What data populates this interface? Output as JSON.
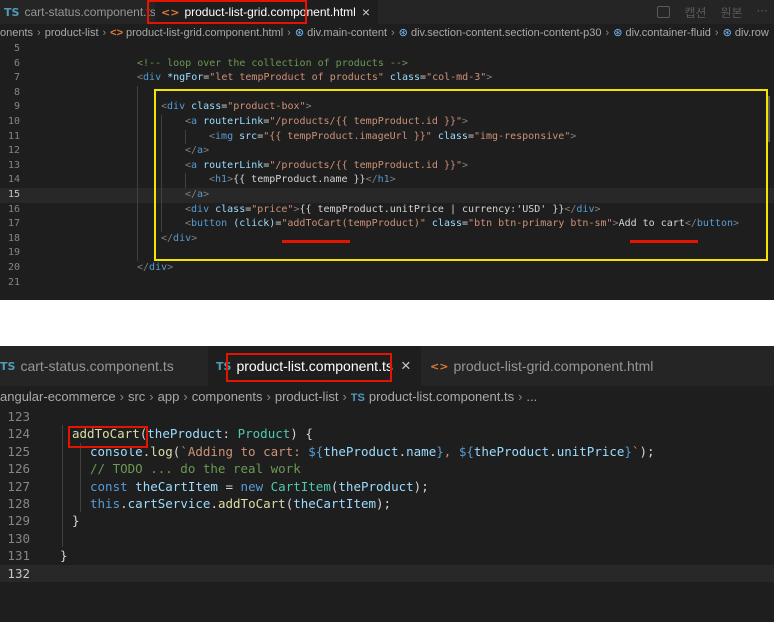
{
  "top_editor": {
    "tabs": [
      {
        "icon": "TS",
        "label": "cart-status.component.ts",
        "active": false
      },
      {
        "icon": "<>",
        "label": "product-list-grid.component.html",
        "active": true
      }
    ],
    "close_glyph": "×",
    "top_right_actions": [
      "캡션",
      "원본",
      "···"
    ],
    "breadcrumb": [
      "onents",
      "product-list",
      "product-list-grid.component.html",
      "div.main-content",
      "div.section-content.section-content-p30",
      "div.container-fluid",
      "div.row"
    ],
    "lines": [
      {
        "n": "5",
        "tokens": []
      },
      {
        "n": "6",
        "tokens": [
          {
            "c": "com",
            "t": "<!-- loop over the collection of products -->"
          }
        ]
      },
      {
        "n": "7",
        "tokens": [
          {
            "c": "br",
            "t": "<"
          },
          {
            "c": "tag",
            "t": "div"
          },
          {
            "c": "txt",
            "t": " "
          },
          {
            "c": "attr",
            "t": "*ngFor"
          },
          {
            "c": "txt",
            "t": "="
          },
          {
            "c": "str",
            "t": "\"let tempProduct of products\""
          },
          {
            "c": "txt",
            "t": " "
          },
          {
            "c": "attr",
            "t": "class"
          },
          {
            "c": "txt",
            "t": "="
          },
          {
            "c": "str",
            "t": "\"col-md-3\""
          },
          {
            "c": "br",
            "t": ">"
          }
        ]
      },
      {
        "n": "8",
        "tokens": []
      },
      {
        "n": "9",
        "tokens": [
          {
            "c": "br",
            "t": "<"
          },
          {
            "c": "tag",
            "t": "div"
          },
          {
            "c": "txt",
            "t": " "
          },
          {
            "c": "attr",
            "t": "class"
          },
          {
            "c": "txt",
            "t": "="
          },
          {
            "c": "str",
            "t": "\"product-box\""
          },
          {
            "c": "br",
            "t": ">"
          }
        ]
      },
      {
        "n": "10",
        "tokens": [
          {
            "c": "br",
            "t": "<"
          },
          {
            "c": "tag",
            "t": "a"
          },
          {
            "c": "txt",
            "t": " "
          },
          {
            "c": "attr",
            "t": "routerLink"
          },
          {
            "c": "txt",
            "t": "="
          },
          {
            "c": "str",
            "t": "\"/products/{{ tempProduct.id }}\""
          },
          {
            "c": "br",
            "t": ">"
          }
        ]
      },
      {
        "n": "11",
        "tokens": [
          {
            "c": "br",
            "t": "<"
          },
          {
            "c": "tag",
            "t": "img"
          },
          {
            "c": "txt",
            "t": " "
          },
          {
            "c": "attr",
            "t": "src"
          },
          {
            "c": "txt",
            "t": "="
          },
          {
            "c": "str",
            "t": "\"{{ tempProduct.imageUrl }}\""
          },
          {
            "c": "txt",
            "t": " "
          },
          {
            "c": "attr",
            "t": "class"
          },
          {
            "c": "txt",
            "t": "="
          },
          {
            "c": "str",
            "t": "\"img-responsive\""
          },
          {
            "c": "br",
            "t": ">"
          }
        ]
      },
      {
        "n": "12",
        "tokens": [
          {
            "c": "br",
            "t": "</"
          },
          {
            "c": "tag",
            "t": "a"
          },
          {
            "c": "br",
            "t": ">"
          }
        ]
      },
      {
        "n": "13",
        "tokens": [
          {
            "c": "br",
            "t": "<"
          },
          {
            "c": "tag",
            "t": "a"
          },
          {
            "c": "txt",
            "t": " "
          },
          {
            "c": "attr",
            "t": "routerLink"
          },
          {
            "c": "txt",
            "t": "="
          },
          {
            "c": "str",
            "t": "\"/products/{{ tempProduct.id }}\""
          },
          {
            "c": "br",
            "t": ">"
          }
        ]
      },
      {
        "n": "14",
        "tokens": [
          {
            "c": "br",
            "t": "<"
          },
          {
            "c": "tag",
            "t": "h1"
          },
          {
            "c": "br",
            "t": ">"
          },
          {
            "c": "txt",
            "t": "{{ tempProduct.name }}"
          },
          {
            "c": "br",
            "t": "</"
          },
          {
            "c": "tag",
            "t": "h1"
          },
          {
            "c": "br",
            "t": ">"
          }
        ]
      },
      {
        "n": "15",
        "tokens": [
          {
            "c": "br",
            "t": "</"
          },
          {
            "c": "tag",
            "t": "a"
          },
          {
            "c": "br",
            "t": ">"
          }
        ]
      },
      {
        "n": "16",
        "tokens": [
          {
            "c": "br",
            "t": "<"
          },
          {
            "c": "tag",
            "t": "div"
          },
          {
            "c": "txt",
            "t": " "
          },
          {
            "c": "attr",
            "t": "class"
          },
          {
            "c": "txt",
            "t": "="
          },
          {
            "c": "str",
            "t": "\"price\""
          },
          {
            "c": "br",
            "t": ">"
          },
          {
            "c": "txt",
            "t": "{{ tempProduct.unitPrice | currency:'USD' }}"
          },
          {
            "c": "br",
            "t": "</"
          },
          {
            "c": "tag",
            "t": "div"
          },
          {
            "c": "br",
            "t": ">"
          }
        ]
      },
      {
        "n": "17",
        "tokens": [
          {
            "c": "br",
            "t": "<"
          },
          {
            "c": "tag",
            "t": "button"
          },
          {
            "c": "txt",
            "t": " "
          },
          {
            "c": "attr",
            "t": "(click)"
          },
          {
            "c": "txt",
            "t": "="
          },
          {
            "c": "str",
            "t": "\"addToCart(tempProduct)\""
          },
          {
            "c": "txt",
            "t": " "
          },
          {
            "c": "attr",
            "t": "class"
          },
          {
            "c": "txt",
            "t": "="
          },
          {
            "c": "str",
            "t": "\"btn btn-primary btn-sm\""
          },
          {
            "c": "br",
            "t": ">"
          },
          {
            "c": "txt",
            "t": "Add to cart"
          },
          {
            "c": "br",
            "t": "</"
          },
          {
            "c": "tag",
            "t": "button"
          },
          {
            "c": "br",
            "t": ">"
          }
        ]
      },
      {
        "n": "18",
        "tokens": [
          {
            "c": "br",
            "t": "</"
          },
          {
            "c": "tag",
            "t": "div"
          },
          {
            "c": "br",
            "t": ">"
          }
        ]
      },
      {
        "n": "19",
        "tokens": []
      },
      {
        "n": "20",
        "tokens": [
          {
            "c": "br",
            "t": "</"
          },
          {
            "c": "tag",
            "t": "div"
          },
          {
            "c": "br",
            "t": ">"
          }
        ]
      },
      {
        "n": "21",
        "tokens": []
      }
    ]
  },
  "bottom_editor": {
    "tabs": [
      {
        "icon": "TS",
        "label": "cart-status.component.ts",
        "active": false
      },
      {
        "icon": "TS",
        "label": "product-list.component.ts",
        "active": true
      },
      {
        "icon": "<>",
        "label": "product-list-grid.component.html",
        "active": false
      }
    ],
    "close_glyph": "×",
    "breadcrumb": [
      "angular-ecommerce",
      "src",
      "app",
      "components",
      "product-list",
      "product-list.component.ts",
      "..."
    ],
    "breadcrumb_file_icon": "TS",
    "lines": [
      {
        "n": "123",
        "tokens": []
      },
      {
        "n": "124",
        "tokens": [
          {
            "c": "fn",
            "t": "addToCart"
          },
          {
            "c": "txt",
            "t": "("
          },
          {
            "c": "var",
            "t": "theProduct"
          },
          {
            "c": "txt",
            "t": ": "
          },
          {
            "c": "type",
            "t": "Product"
          },
          {
            "c": "txt",
            "t": ") {"
          }
        ]
      },
      {
        "n": "125",
        "tokens": [
          {
            "c": "var",
            "t": "console"
          },
          {
            "c": "txt",
            "t": "."
          },
          {
            "c": "fn",
            "t": "log"
          },
          {
            "c": "txt",
            "t": "("
          },
          {
            "c": "str",
            "t": "`Adding to cart: "
          },
          {
            "c": "kw",
            "t": "${"
          },
          {
            "c": "var",
            "t": "theProduct"
          },
          {
            "c": "txt",
            "t": "."
          },
          {
            "c": "var",
            "t": "name"
          },
          {
            "c": "kw",
            "t": "}"
          },
          {
            "c": "str",
            "t": ", "
          },
          {
            "c": "kw",
            "t": "${"
          },
          {
            "c": "var",
            "t": "theProduct"
          },
          {
            "c": "txt",
            "t": "."
          },
          {
            "c": "var",
            "t": "unitPrice"
          },
          {
            "c": "kw",
            "t": "}"
          },
          {
            "c": "str",
            "t": "`"
          },
          {
            "c": "txt",
            "t": ");"
          }
        ]
      },
      {
        "n": "126",
        "tokens": [
          {
            "c": "com",
            "t": "// TODO ... do the real work"
          }
        ]
      },
      {
        "n": "127",
        "tokens": [
          {
            "c": "kw",
            "t": "const"
          },
          {
            "c": "txt",
            "t": " "
          },
          {
            "c": "var",
            "t": "theCartItem"
          },
          {
            "c": "txt",
            "t": " = "
          },
          {
            "c": "kw",
            "t": "new"
          },
          {
            "c": "txt",
            "t": " "
          },
          {
            "c": "type",
            "t": "CartItem"
          },
          {
            "c": "txt",
            "t": "("
          },
          {
            "c": "var",
            "t": "theProduct"
          },
          {
            "c": "txt",
            "t": ");"
          }
        ]
      },
      {
        "n": "128",
        "tokens": [
          {
            "c": "kw",
            "t": "this"
          },
          {
            "c": "txt",
            "t": "."
          },
          {
            "c": "var",
            "t": "cartService"
          },
          {
            "c": "txt",
            "t": "."
          },
          {
            "c": "fn",
            "t": "addToCart"
          },
          {
            "c": "txt",
            "t": "("
          },
          {
            "c": "var",
            "t": "theCartItem"
          },
          {
            "c": "txt",
            "t": ");"
          }
        ]
      },
      {
        "n": "129",
        "tokens": [
          {
            "c": "txt",
            "t": "}"
          }
        ]
      },
      {
        "n": "130",
        "tokens": []
      },
      {
        "n": "131",
        "tokens": [
          {
            "c": "txt",
            "t": "}"
          }
        ]
      },
      {
        "n": "132",
        "tokens": []
      }
    ]
  },
  "colors": {
    "highlight_red": "#e51400",
    "highlight_yellow": "#f5e400",
    "editor_bg": "#1e1e1e",
    "tab_bg": "#252526"
  }
}
